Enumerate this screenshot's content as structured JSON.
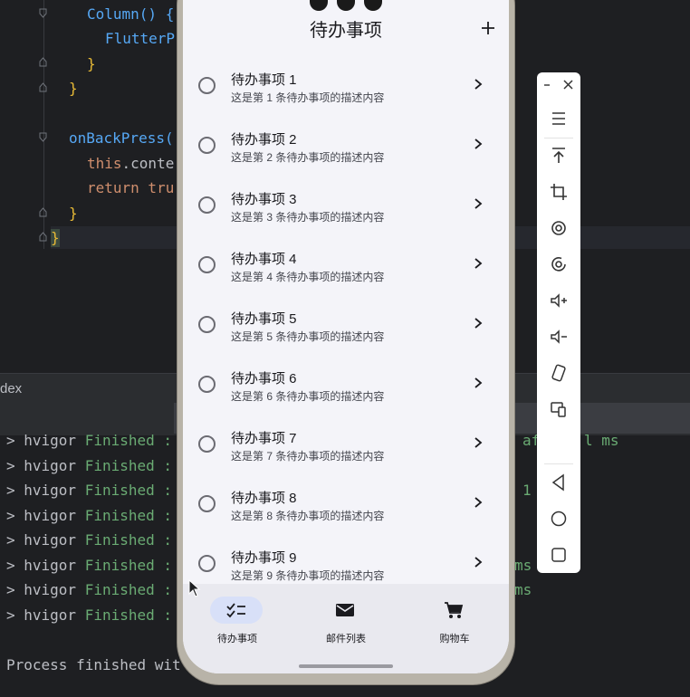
{
  "editor": {
    "lines": [
      {
        "text": "Column() {",
        "kind": "fn"
      },
      {
        "text": "FlutterP",
        "kind": "fn"
      },
      {
        "text": "}",
        "kind": "yellow"
      },
      {
        "text": "}",
        "kind": "yellow"
      },
      {
        "text": "onBackPress(",
        "kind": "fn"
      },
      {
        "text_kw": "this",
        "text_rest": ".conte"
      },
      {
        "text_kw": "return",
        "text_rest": " tru"
      },
      {
        "text": "}",
        "kind": "yellow"
      },
      {
        "text": "}",
        "kind": "yellow"
      }
    ]
  },
  "panel": {
    "title": "dex"
  },
  "console": {
    "lines": [
      {
        "prefix": "> hvigor ",
        "status": "Finished :"
      },
      {
        "prefix": "> hvigor ",
        "status": "Finished :"
      },
      {
        "prefix": "> hvigor ",
        "status": "Finished :"
      },
      {
        "prefix": "> hvigor ",
        "status": "Finished :"
      },
      {
        "prefix": "> hvigor ",
        "status": "Finished :"
      },
      {
        "prefix": "> hvigor ",
        "status": "Finished :"
      },
      {
        "prefix": "> hvigor ",
        "status": "Finished :"
      },
      {
        "prefix": "> hvigor ",
        "status": "Finished :"
      }
    ],
    "right_fragments": [
      "af",
      "l ms",
      "1",
      "ms",
      "ms"
    ],
    "process_line": "Process finished wit"
  },
  "app": {
    "title": "待办事项",
    "todos": [
      {
        "title": "待办事项 1",
        "desc": "这是第 1 条待办事项的描述内容"
      },
      {
        "title": "待办事项 2",
        "desc": "这是第 2 条待办事项的描述内容"
      },
      {
        "title": "待办事项 3",
        "desc": "这是第 3 条待办事项的描述内容"
      },
      {
        "title": "待办事项 4",
        "desc": "这是第 4 条待办事项的描述内容"
      },
      {
        "title": "待办事项 5",
        "desc": "这是第 5 条待办事项的描述内容"
      },
      {
        "title": "待办事项 6",
        "desc": "这是第 6 条待办事项的描述内容"
      },
      {
        "title": "待办事项 7",
        "desc": "这是第 7 条待办事项的描述内容"
      },
      {
        "title": "待办事项 8",
        "desc": "这是第 8 条待办事项的描述内容"
      },
      {
        "title": "待办事项 9",
        "desc": "这是第 9 条待办事项的描述内容"
      }
    ],
    "nav": [
      {
        "label": "待办事项",
        "icon": "checklist-icon",
        "active": true
      },
      {
        "label": "邮件列表",
        "icon": "mail-icon",
        "active": false
      },
      {
        "label": "购物车",
        "icon": "cart-icon",
        "active": false
      }
    ]
  },
  "emulator_toolbar": {
    "buttons": [
      "minimize-icon",
      "close-icon",
      "menu-icon",
      "top-icon",
      "crop-icon",
      "rotate-icon",
      "screenshot-icon",
      "volume-up-icon",
      "volume-down-icon",
      "shake-icon",
      "multi-screen-icon",
      "back-icon",
      "home-icon",
      "recents-icon"
    ]
  },
  "colors": {
    "ide_bg": "#1e1f22",
    "phone_screen": "#f4f4f9",
    "nav_active": "#d8e0f8",
    "green": "#6aab73"
  }
}
